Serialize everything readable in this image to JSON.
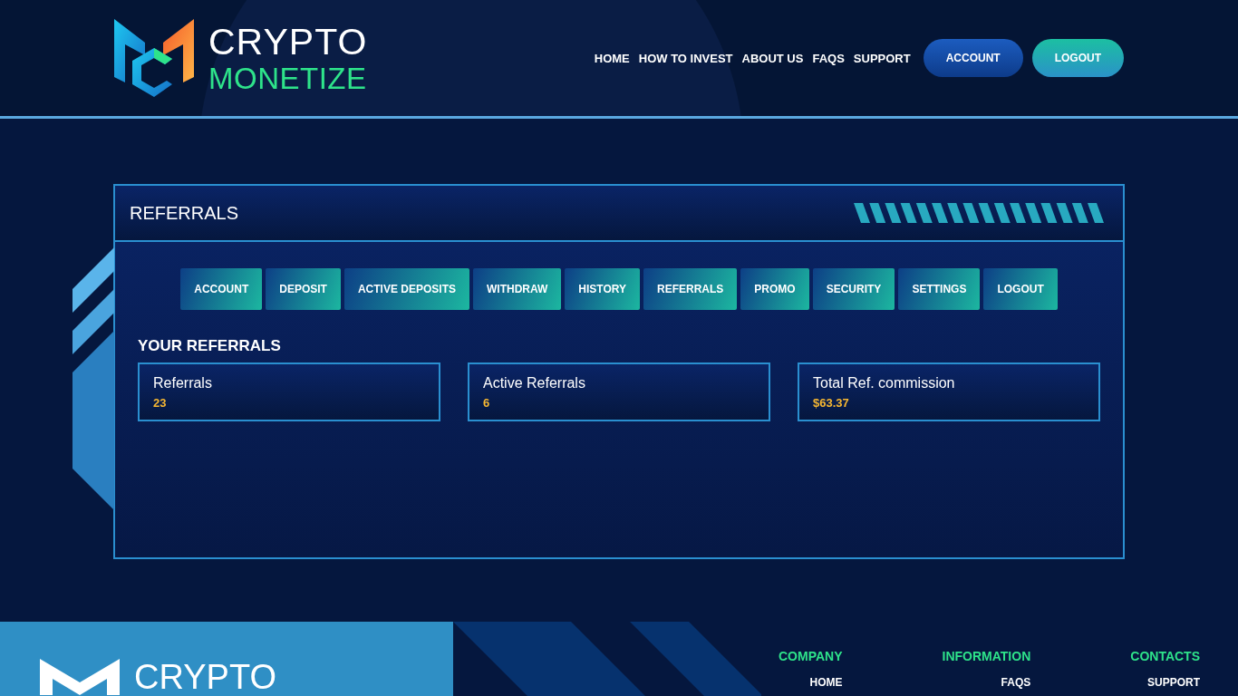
{
  "header": {
    "logo": {
      "line_1": "CRYPTO",
      "line_2": "MONETIZE"
    },
    "nav": [
      "HOME",
      "HOW TO INVEST",
      "ABOUT US",
      "FAQS",
      "SUPPORT"
    ],
    "buttons": [
      {
        "label": "ACCOUNT",
        "kind": "primary"
      },
      {
        "label": "LOGOUT",
        "kind": "secondary"
      }
    ]
  },
  "panel": {
    "title": "REFERRALS",
    "tabs": [
      "ACCOUNT",
      "DEPOSIT",
      "ACTIVE DEPOSITS",
      "WITHDRAW",
      "HISTORY",
      "REFERRALS",
      "PROMO",
      "SECURITY",
      "SETTINGS",
      "LOGOUT"
    ],
    "section_title": "YOUR REFERRALS",
    "stats": [
      {
        "label": "Referrals",
        "value": "23"
      },
      {
        "label": "Active Referrals",
        "value": "6"
      },
      {
        "label": "Total Ref. commission",
        "value": "$63.37"
      }
    ]
  },
  "footer": {
    "logo": "CRYPTO",
    "columns": [
      {
        "heading": "COMPANY",
        "links": [
          "HOME"
        ]
      },
      {
        "heading": "INFORMATION",
        "links": [
          "FAQS"
        ]
      },
      {
        "heading": "CONTACTS",
        "links": [
          "SUPPORT"
        ]
      }
    ]
  }
}
